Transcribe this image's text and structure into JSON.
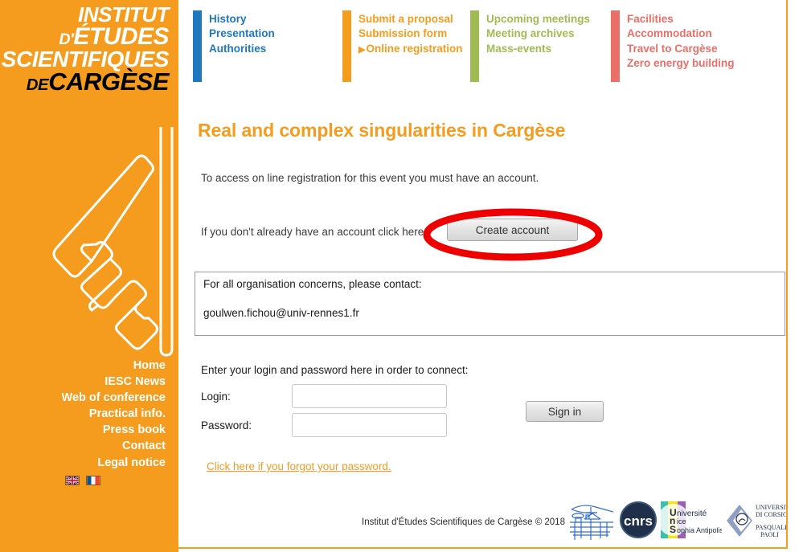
{
  "theme": {
    "orange": "#f59c1e",
    "nav_blue": "#1f78be",
    "nav_orange": "#f59c1e",
    "nav_green": "#a0bb52",
    "nav_red": "#ea6f68",
    "highlight_red": "#ee0000"
  },
  "sidebar": {
    "logo": {
      "line1": "INSTITUT",
      "line2_small": "D'",
      "line2": "ÉTUDES",
      "line3": "SCIENTIFIQUES",
      "line4_small": "DE",
      "line4": "CARGÈSE"
    },
    "graphic_name": "iesc-monogram-graphic",
    "menu": [
      {
        "label": "Home"
      },
      {
        "label": "IESC News"
      },
      {
        "label": "Web of conference"
      },
      {
        "label": "Practical info."
      },
      {
        "label": "Press book"
      },
      {
        "label": "Contact"
      },
      {
        "label": "Legal notice"
      }
    ],
    "flags": [
      {
        "name": "flag-uk",
        "title": "English"
      },
      {
        "name": "flag-france",
        "title": "Français"
      }
    ]
  },
  "topnav": {
    "columns": [
      {
        "accent": "#1f78be",
        "text_color": "#1f78be",
        "items": [
          {
            "label": "History",
            "active": false
          },
          {
            "label": "Presentation",
            "active": false
          },
          {
            "label": "Authorities",
            "active": false
          }
        ]
      },
      {
        "accent": "#f59c1e",
        "text_color": "#f59c1e",
        "items": [
          {
            "label": "Submit a proposal",
            "active": false
          },
          {
            "label": "Submission form",
            "active": false
          },
          {
            "label": "Online registration",
            "active": true,
            "caret": "▶"
          }
        ]
      },
      {
        "accent": "#a0bb52",
        "text_color": "#a0bb52",
        "items": [
          {
            "label": "Upcoming meetings",
            "active": false
          },
          {
            "label": "Meeting archives",
            "active": false
          },
          {
            "label": "Mass-events",
            "active": false
          }
        ]
      },
      {
        "accent": "#ea6f68",
        "text_color": "#ea6f68",
        "items": [
          {
            "label": "Facilities",
            "active": false
          },
          {
            "label": "Accommodation",
            "active": false
          },
          {
            "label": "Travel to Cargèse",
            "active": false
          },
          {
            "label": "Zero energy building",
            "active": false
          }
        ]
      }
    ]
  },
  "main": {
    "title": "Real and complex singularities in Cargèse",
    "intro": "To access on line registration for this event you must have an account.",
    "create_account_text": "If you don't already have an account click here:",
    "create_account_button": "Create account",
    "contact": {
      "heading": "For all organisation concerns, please contact:",
      "email": "goulwen.fichou@univ-rennes1.fr"
    },
    "login": {
      "prompt": "Enter your login and password here in order to connect:",
      "login_label": "Login:",
      "login_value": "",
      "password_label": "Password:",
      "password_value": "",
      "signin_button": "Sign in",
      "forgot_link": "Click here if you forgot your password."
    }
  },
  "footer": {
    "copyright": "Institut d'Études Scientifiques de Cargèse © 2018",
    "logos": [
      {
        "name": "iesc-building-logo",
        "text": ""
      },
      {
        "name": "cnrs-logo",
        "text": "cnrs"
      },
      {
        "name": "universite-nice-sophia-antipolis-logo",
        "text": "Université Nice Sophia Antipolis"
      },
      {
        "name": "universita-di-corsica-pasquale-paoli-logo",
        "text": "Università di Corsica Pasquale Paoli"
      }
    ]
  }
}
